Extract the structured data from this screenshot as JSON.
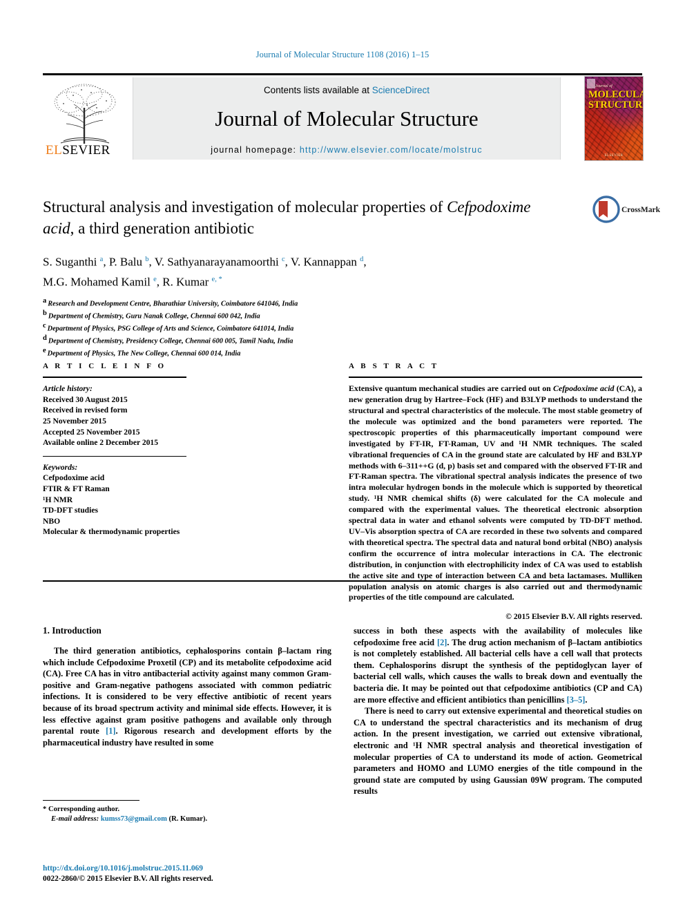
{
  "running_head": "Journal of Molecular Structure 1108 (2016) 1–15",
  "masthead": {
    "contents_prefix": "Contents lists available at ",
    "sciencedirect": "ScienceDirect",
    "journal_title": "Journal of Molecular Structure",
    "homepage_label": "journal homepage: ",
    "homepage_url": "http://www.elsevier.com/locate/molstruc",
    "publisher": "ELSEVIER",
    "cover": {
      "journal_word": "Journal of",
      "line1": "MOLECULAR",
      "line2": "STRUCTURE",
      "footer": "ELSEVIER"
    }
  },
  "crossmark": {
    "label": "CrossMark"
  },
  "title": {
    "line1": "Structural analysis and investigation of molecular properties of",
    "italic_part": "Cefpodoxime acid",
    "line2_rest": ", a third generation antibiotic"
  },
  "authors": {
    "line1": [
      {
        "name": "S. Suganthi ",
        "sup": "a"
      },
      {
        "name": ", P. Balu ",
        "sup": "b"
      },
      {
        "name": ", V. Sathyanarayanamoorthi ",
        "sup": "c"
      },
      {
        "name": ", V. Kannappan ",
        "sup": "d"
      }
    ],
    "line2": [
      {
        "name": "M.G. Mohamed Kamil ",
        "sup": "e"
      },
      {
        "name": ", R. Kumar ",
        "sup": "e, *"
      }
    ]
  },
  "affiliations": [
    {
      "marker": "a",
      "text": "Research and Development Centre, Bharathiar University, Coimbatore 641046, India"
    },
    {
      "marker": "b",
      "text": "Department of Chemistry, Guru Nanak College, Chennai 600 042, India"
    },
    {
      "marker": "c",
      "text": "Department of Physics, PSG College of Arts and Science, Coimbatore 641014, India"
    },
    {
      "marker": "d",
      "text": "Department of Chemistry, Presidency College, Chennai 600 005, Tamil Nadu, India"
    },
    {
      "marker": "e",
      "text": "Department of Physics, The New College, Chennai 600 014, India"
    }
  ],
  "article_info": {
    "heading": "A R T I C L E   I N F O",
    "history_title": "Article history:",
    "history": [
      "Received 30 August 2015",
      "Received in revised form",
      "25 November 2015",
      "Accepted 25 November 2015",
      "Available online 2 December 2015"
    ],
    "keywords_title": "Keywords:",
    "keywords": [
      "Cefpodoxime acid",
      "FTIR & FT Raman",
      "¹H NMR",
      "TD-DFT studies",
      "NBO",
      "Molecular & thermodynamic properties"
    ]
  },
  "abstract": {
    "heading": "A B S T R A C T",
    "part1": "Extensive quantum mechanical studies are carried out on ",
    "italic1": "Cefpodoxime acid",
    "part2": " (CA), a new generation drug by Hartree–Fock (HF) and B3LYP methods to understand the structural and spectral characteristics of the molecule. The most stable geometry of the molecule was optimized and the bond parameters were reported. The spectroscopic properties of this pharmaceutically important compound were investigated by FT-IR, FT-Raman, UV and ¹H NMR techniques. The scaled vibrational frequencies of CA in the ground state are calculated by HF and B3LYP methods with 6–311++G (d, p) basis set and compared with the observed FT-IR and FT-Raman spectra. The vibrational spectral analysis indicates the presence of two intra molecular hydrogen bonds in the molecule which is supported by theoretical study. ¹H NMR chemical shifts (δ) were calculated for the CA molecule and compared with the experimental values. The theoretical electronic absorption spectral data in water and ethanol solvents were computed by TD-DFT method. UV–Vis absorption spectra of CA are recorded in these two solvents and compared with theoretical spectra. The spectral data and natural bond orbital (NBO) analysis confirm the occurrence of intra molecular interactions in CA. The electronic distribution, in conjunction with electrophilicity index of CA was used to establish the active site and type of interaction between CA and beta lactamases. Mulliken population analysis on atomic charges is also carried out and thermodynamic properties of the title compound are calculated.",
    "copyright": "© 2015 Elsevier B.V. All rights reserved."
  },
  "introduction": {
    "section_title": "1.  Introduction",
    "left_p1_a": "The third generation antibiotics, cephalosporins contain β–lactam ring which include Cefpodoxime Proxetil (CP) and its metabolite cefpodoxime acid (CA). Free CA has in vitro antibacterial activity against many common Gram-positive and Gram-negative pathogens associated with common pediatric infections. It is considered to be very effective antibiotic of recent years because of its broad spectrum activity and minimal side effects. However, it is less effective against gram positive pathogens and available only through parental route ",
    "left_ref1": "[1]",
    "left_p1_b": ". Rigorous research and development efforts by the pharmaceutical industry have resulted in some",
    "right_p1_a": "success in both these aspects with the availability of molecules like cefpodoxime free acid ",
    "right_ref2": "[2]",
    "right_p1_b": ". The drug action mechanism of β–lactam antibiotics is not completely established. All bacterial cells have a cell wall that protects them. Cephalosporins disrupt the synthesis of the peptidoglycan layer of bacterial cell walls, which causes the walls to break down and eventually the bacteria die. It may be pointed out that cefpodoxime antibiotics (CP and CA) are more effective and efficient antibiotics than penicillins ",
    "right_ref35": "[3–5]",
    "right_p1_c": ".",
    "right_p2": "There is need to carry out extensive experimental and theoretical studies on CA to understand the spectral characteristics and its mechanism of drug action. In the present investigation, we carried out extensive vibrational, electronic and ¹H NMR spectral analysis and theoretical investigation of molecular properties of CA to understand its mode of action. Geometrical parameters and HOMO and LUMO energies of the title compound in the ground state are computed by using Gaussian 09W program. The computed results"
  },
  "footnote": {
    "corresponding": "* Corresponding author.",
    "email_label": "E-mail address: ",
    "email": "kumss73@gmail.com",
    "email_suffix": " (R. Kumar)."
  },
  "doi": {
    "url": "http://dx.doi.org/10.1016/j.molstruc.2015.11.069",
    "issn_line": "0022-2860/© 2015 Elsevier B.V. All rights reserved."
  },
  "colors": {
    "link_blue": "#1a7bb0",
    "elsevier_orange": "#ef7d1a",
    "banner_gray": "#eceded"
  }
}
